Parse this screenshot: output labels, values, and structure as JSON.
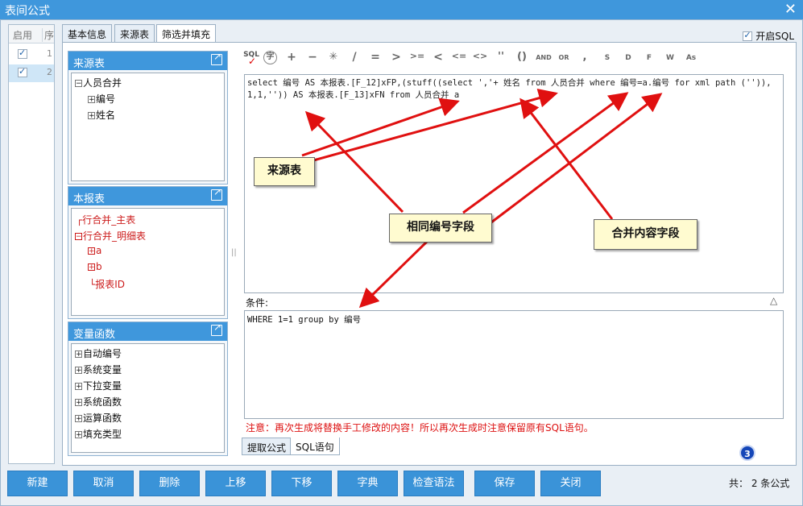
{
  "window": {
    "title": "表间公式"
  },
  "left_table": {
    "headers": [
      "启用",
      "序"
    ],
    "rows": [
      {
        "enabled": true,
        "seq": "1"
      },
      {
        "enabled": true,
        "seq": "2"
      }
    ]
  },
  "tabs": [
    "基本信息",
    "来源表",
    "筛选并填充"
  ],
  "open_sql": {
    "label": "开启SQL",
    "checked": true
  },
  "panels": {
    "source": {
      "title": "来源表",
      "items": [
        {
          "label": "人员合并",
          "level": 0,
          "sign": "-"
        },
        {
          "label": "编号",
          "level": 1,
          "sign": "+"
        },
        {
          "label": "姓名",
          "level": 1,
          "sign": "+"
        }
      ]
    },
    "report": {
      "title": "本报表",
      "items": [
        {
          "label": "行合并_主表",
          "level": 0,
          "sign": ""
        },
        {
          "label": "行合并_明细表",
          "level": 0,
          "sign": "-"
        },
        {
          "label": "a",
          "level": 1,
          "sign": "+"
        },
        {
          "label": "b",
          "level": 1,
          "sign": "+"
        },
        {
          "label": "报表ID",
          "level": 1,
          "sign": ""
        }
      ]
    },
    "vars": {
      "title": "变量函数",
      "items": [
        {
          "label": "自动编号",
          "level": 0,
          "sign": "+"
        },
        {
          "label": "系统变量",
          "level": 0,
          "sign": "+"
        },
        {
          "label": "下拉变量",
          "level": 0,
          "sign": "+"
        },
        {
          "label": "系统函数",
          "level": 0,
          "sign": "+"
        },
        {
          "label": "运算函数",
          "level": 0,
          "sign": "+"
        },
        {
          "label": "填充类型",
          "level": 0,
          "sign": "+"
        }
      ]
    }
  },
  "toolbar": [
    "SQL",
    "字",
    "+",
    "−",
    "✳",
    "/",
    "=",
    ">",
    ">=",
    "<",
    "<=",
    "<>",
    "''",
    "()",
    "AND",
    "OR",
    ",",
    "S",
    "D",
    "F",
    "W",
    "As"
  ],
  "sql_text": "select 编号 AS 本报表.[F_12]xFP,(stuff((select ','+ 姓名 from 人员合并 where 编号=a.编号 for xml path ('')),1,1,'')) AS 本报表.[F_13]xFN from 人员合并 a",
  "condition_label": "条件:",
  "condition_text": "WHERE 1=1 group by 编号",
  "warning": "注意：再次生成将替换手工修改的内容！所以再次生成时注意保留原有SQL语句。",
  "bottom_tabs": [
    "提取公式",
    "SQL语句"
  ],
  "badge": "3",
  "buttons": [
    "新建",
    "取消",
    "删除",
    "上移",
    "下移",
    "字典",
    "检查语法",
    "保存",
    "关闭"
  ],
  "count_text": "共：  2 条公式",
  "callouts": {
    "source_table": "来源表",
    "same_id_field": "相同编号字段",
    "merge_content_field": "合并内容字段"
  },
  "colors": {
    "accent": "#3f97dc",
    "annotation_arrow": "#e01010",
    "warning": "#dd1111"
  }
}
